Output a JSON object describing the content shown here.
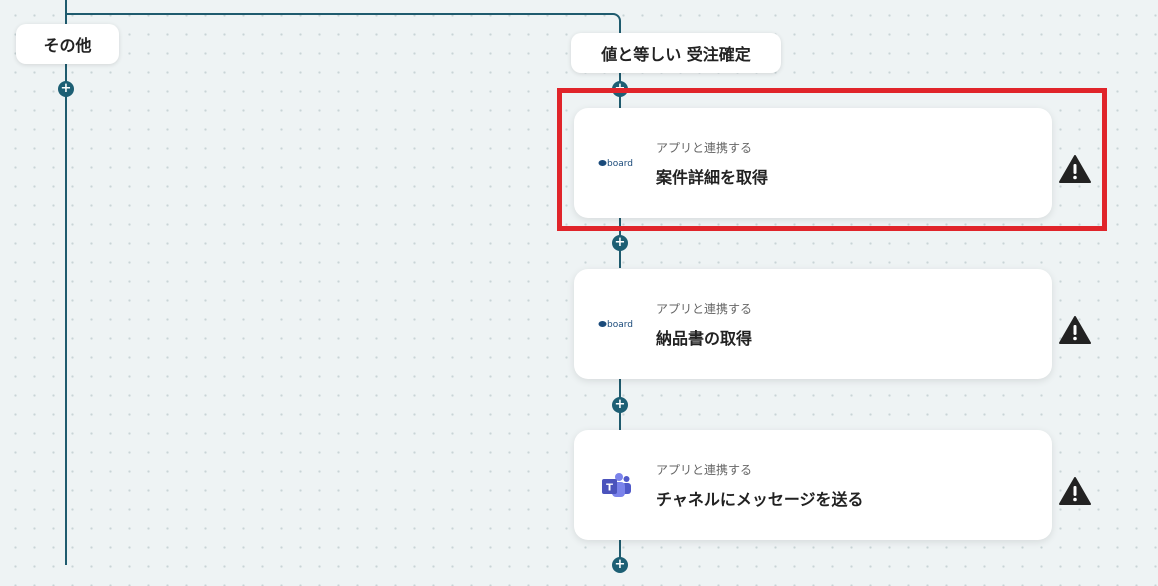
{
  "branches": {
    "left_label": "その他",
    "right_label": "値と等しい 受注確定"
  },
  "cards": [
    {
      "icon": "board-logo-icon",
      "subtitle": "アプリと連携する",
      "title": "案件詳細を取得"
    },
    {
      "icon": "board-logo-icon",
      "subtitle": "アプリと連携する",
      "title": "納品書の取得"
    },
    {
      "icon": "teams-logo-icon",
      "subtitle": "アプリと連携する",
      "title": "チャネルにメッセージを送る"
    }
  ],
  "add_symbol": "+",
  "colors": {
    "connector": "#1f5b6e",
    "add_button": "#1d5f74",
    "highlight": "#e0242a",
    "warning": "#222222",
    "board_brand": "#1a4a7a",
    "teams_brand": "#5059c9"
  }
}
